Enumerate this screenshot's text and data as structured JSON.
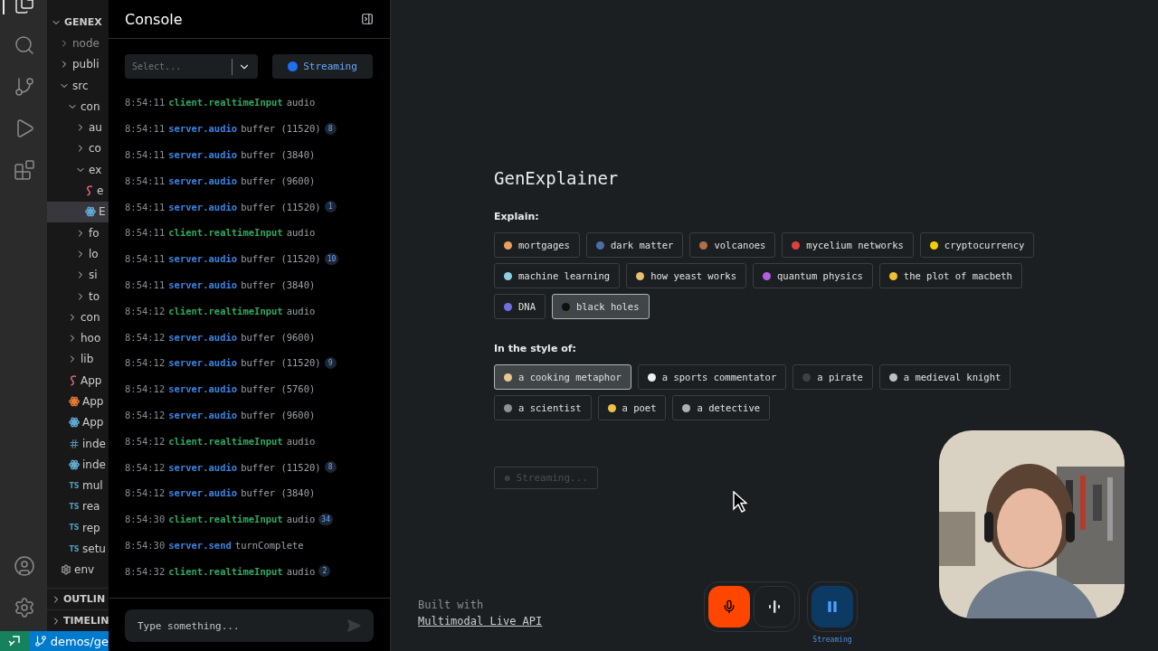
{
  "activity_bar": {
    "top": [
      {
        "kind": "files",
        "selected": true
      },
      {
        "kind": "search",
        "selected": false
      },
      {
        "kind": "source_control",
        "selected": false
      },
      {
        "kind": "run_debug",
        "selected": false
      },
      {
        "kind": "extensions",
        "selected": false
      }
    ],
    "bottom": [
      {
        "kind": "account"
      },
      {
        "kind": "settings"
      }
    ]
  },
  "explorer": {
    "root": {
      "label": "GENEX",
      "expanded": true,
      "children": [
        {
          "label": "node",
          "kind": "folder",
          "expanded": false,
          "selected": false
        },
        {
          "label": "publi",
          "kind": "folder",
          "expanded": false,
          "selected": false
        },
        {
          "label": "src",
          "kind": "folder",
          "expanded": true,
          "selected": false,
          "children": [
            {
              "label": "con",
              "kind": "folder",
              "expanded": true,
              "selected": false,
              "children": [
                {
                  "label": "au",
                  "kind": "folder",
                  "expanded": false,
                  "selected": false
                },
                {
                  "label": "co",
                  "kind": "folder",
                  "expanded": false,
                  "selected": false
                },
                {
                  "label": "ex",
                  "kind": "folder",
                  "expanded": true,
                  "selected": false,
                  "children": [
                    {
                      "label": "e",
                      "kind": "sass",
                      "color": "#e0607e",
                      "selected": false
                    },
                    {
                      "label": "E",
                      "kind": "react",
                      "color": "#5fa8d3",
                      "selected": true
                    }
                  ]
                },
                {
                  "label": "fo",
                  "kind": "folder",
                  "expanded": false,
                  "selected": false
                },
                {
                  "label": "lo",
                  "kind": "folder",
                  "expanded": false,
                  "selected": false
                },
                {
                  "label": "si",
                  "kind": "folder",
                  "expanded": false,
                  "selected": false
                },
                {
                  "label": "to",
                  "kind": "folder",
                  "expanded": false,
                  "selected": false
                }
              ]
            },
            {
              "label": "con",
              "kind": "folder",
              "expanded": false,
              "selected": false
            },
            {
              "label": "hoo",
              "kind": "folder",
              "expanded": false,
              "selected": false
            },
            {
              "label": "lib",
              "kind": "folder",
              "expanded": false,
              "selected": false
            },
            {
              "label": "App",
              "kind": "sass",
              "color": "#e0607e",
              "selected": false
            },
            {
              "label": "App",
              "kind": "react",
              "color": "#e37933",
              "selected": false
            },
            {
              "label": "App",
              "kind": "react",
              "color": "#5fa8d3",
              "selected": false
            },
            {
              "label": "inde",
              "kind": "css",
              "color": "#519aba",
              "selected": false
            },
            {
              "label": "inde",
              "kind": "react",
              "color": "#5fa8d3",
              "selected": false
            },
            {
              "label": "mul",
              "kind": "ts",
              "badge": "TS",
              "color": "#519aba",
              "selected": false
            },
            {
              "label": "rea",
              "kind": "ts",
              "badge": "TS",
              "color": "#519aba",
              "selected": false
            },
            {
              "label": "rep",
              "kind": "ts",
              "badge": "TS",
              "color": "#519aba",
              "selected": false
            },
            {
              "label": "setu",
              "kind": "ts",
              "badge": "TS",
              "color": "#519aba",
              "selected": false
            }
          ]
        },
        {
          "label": "env",
          "kind": "settings",
          "color": "#8a8a8a",
          "selected": false
        }
      ]
    },
    "sections": [
      {
        "label": "OUTLIN",
        "expanded": false
      },
      {
        "label": "TIMELIN",
        "expanded": false
      }
    ]
  },
  "status_bar": {
    "branch": "demos/ge"
  },
  "console": {
    "title": "Console",
    "filter": {
      "placeholder": "Select..."
    },
    "stream_button": {
      "label": "Streaming",
      "on": true
    },
    "logs": [
      {
        "time": "8:54:11",
        "source": "client.realtimeInput",
        "kind": "client",
        "message": "audio"
      },
      {
        "time": "8:54:11",
        "source": "server.audio",
        "kind": "server",
        "message": "buffer (11520)",
        "count": "8"
      },
      {
        "time": "8:54:11",
        "source": "server.audio",
        "kind": "server",
        "message": "buffer (3840)"
      },
      {
        "time": "8:54:11",
        "source": "server.audio",
        "kind": "server",
        "message": "buffer (9600)"
      },
      {
        "time": "8:54:11",
        "source": "server.audio",
        "kind": "server",
        "message": "buffer (11520)",
        "count": "1"
      },
      {
        "time": "8:54:11",
        "source": "client.realtimeInput",
        "kind": "client",
        "message": "audio"
      },
      {
        "time": "8:54:11",
        "source": "server.audio",
        "kind": "server",
        "message": "buffer (11520)",
        "count": "10"
      },
      {
        "time": "8:54:11",
        "source": "server.audio",
        "kind": "server",
        "message": "buffer (3840)"
      },
      {
        "time": "8:54:12",
        "source": "client.realtimeInput",
        "kind": "client",
        "message": "audio"
      },
      {
        "time": "8:54:12",
        "source": "server.audio",
        "kind": "server",
        "message": "buffer (9600)"
      },
      {
        "time": "8:54:12",
        "source": "server.audio",
        "kind": "server",
        "message": "buffer (11520)",
        "count": "9"
      },
      {
        "time": "8:54:12",
        "source": "server.audio",
        "kind": "server",
        "message": "buffer (5760)"
      },
      {
        "time": "8:54:12",
        "source": "server.audio",
        "kind": "server",
        "message": "buffer (9600)"
      },
      {
        "time": "8:54:12",
        "source": "client.realtimeInput",
        "kind": "client",
        "message": "audio"
      },
      {
        "time": "8:54:12",
        "source": "server.audio",
        "kind": "server",
        "message": "buffer (11520)",
        "count": "8"
      },
      {
        "time": "8:54:12",
        "source": "server.audio",
        "kind": "server",
        "message": "buffer (3840)"
      },
      {
        "time": "8:54:30",
        "source": "client.realtimeInput",
        "kind": "client",
        "message": "audio",
        "count": "34"
      },
      {
        "time": "8:54:30",
        "source": "server.send",
        "kind": "server",
        "message": "turnComplete"
      },
      {
        "time": "8:54:32",
        "source": "client.realtimeInput",
        "kind": "client",
        "message": "audio",
        "count": "2"
      }
    ],
    "input": {
      "placeholder": "Type something..."
    }
  },
  "main": {
    "title": "GenExplainer",
    "topics": {
      "label": "Explain:",
      "chips": [
        {
          "label": "mortgages",
          "color": "#e8a060",
          "selected": false
        },
        {
          "label": "dark matter",
          "color": "#4a6fa8",
          "selected": false
        },
        {
          "label": "volcanoes",
          "color": "#b07040",
          "selected": false
        },
        {
          "label": "mycelium networks",
          "color": "#e04040",
          "selected": false
        },
        {
          "label": "cryptocurrency",
          "color": "#f5d000",
          "selected": false
        },
        {
          "label": "machine learning",
          "color": "#8fd0e0",
          "selected": false
        },
        {
          "label": "how yeast works",
          "color": "#e8c070",
          "selected": false
        },
        {
          "label": "quantum physics",
          "color": "#b060e0",
          "selected": false
        },
        {
          "label": "the plot of macbeth",
          "color": "#f0c030",
          "selected": false
        },
        {
          "label": "DNA",
          "color": "#7070e0",
          "selected": false
        },
        {
          "label": "black holes",
          "color": "#101010",
          "selected": true
        }
      ]
    },
    "styles": {
      "label": "In the style of:",
      "chips": [
        {
          "label": "a cooking metaphor",
          "color": "#e8c890",
          "selected": true
        },
        {
          "label": "a sports commentator",
          "color": "#f0f0f0",
          "selected": false
        },
        {
          "label": "a pirate",
          "color": "#404040",
          "selected": false
        },
        {
          "label": "a medieval knight",
          "color": "#c0c0c0",
          "selected": false
        },
        {
          "label": "a scientist",
          "color": "#909090",
          "selected": false
        },
        {
          "label": "a poet",
          "color": "#f0c040",
          "selected": false
        },
        {
          "label": "a detective",
          "color": "#b0b0b0",
          "selected": false
        }
      ]
    },
    "submit": {
      "label": "Streaming...",
      "disabled": true
    },
    "footer": {
      "caption": "Built with",
      "link": "Multimodal Live API"
    },
    "controls": {
      "mic": {
        "on": true
      },
      "pause": {
        "on": true,
        "label": "Streaming"
      }
    }
  }
}
